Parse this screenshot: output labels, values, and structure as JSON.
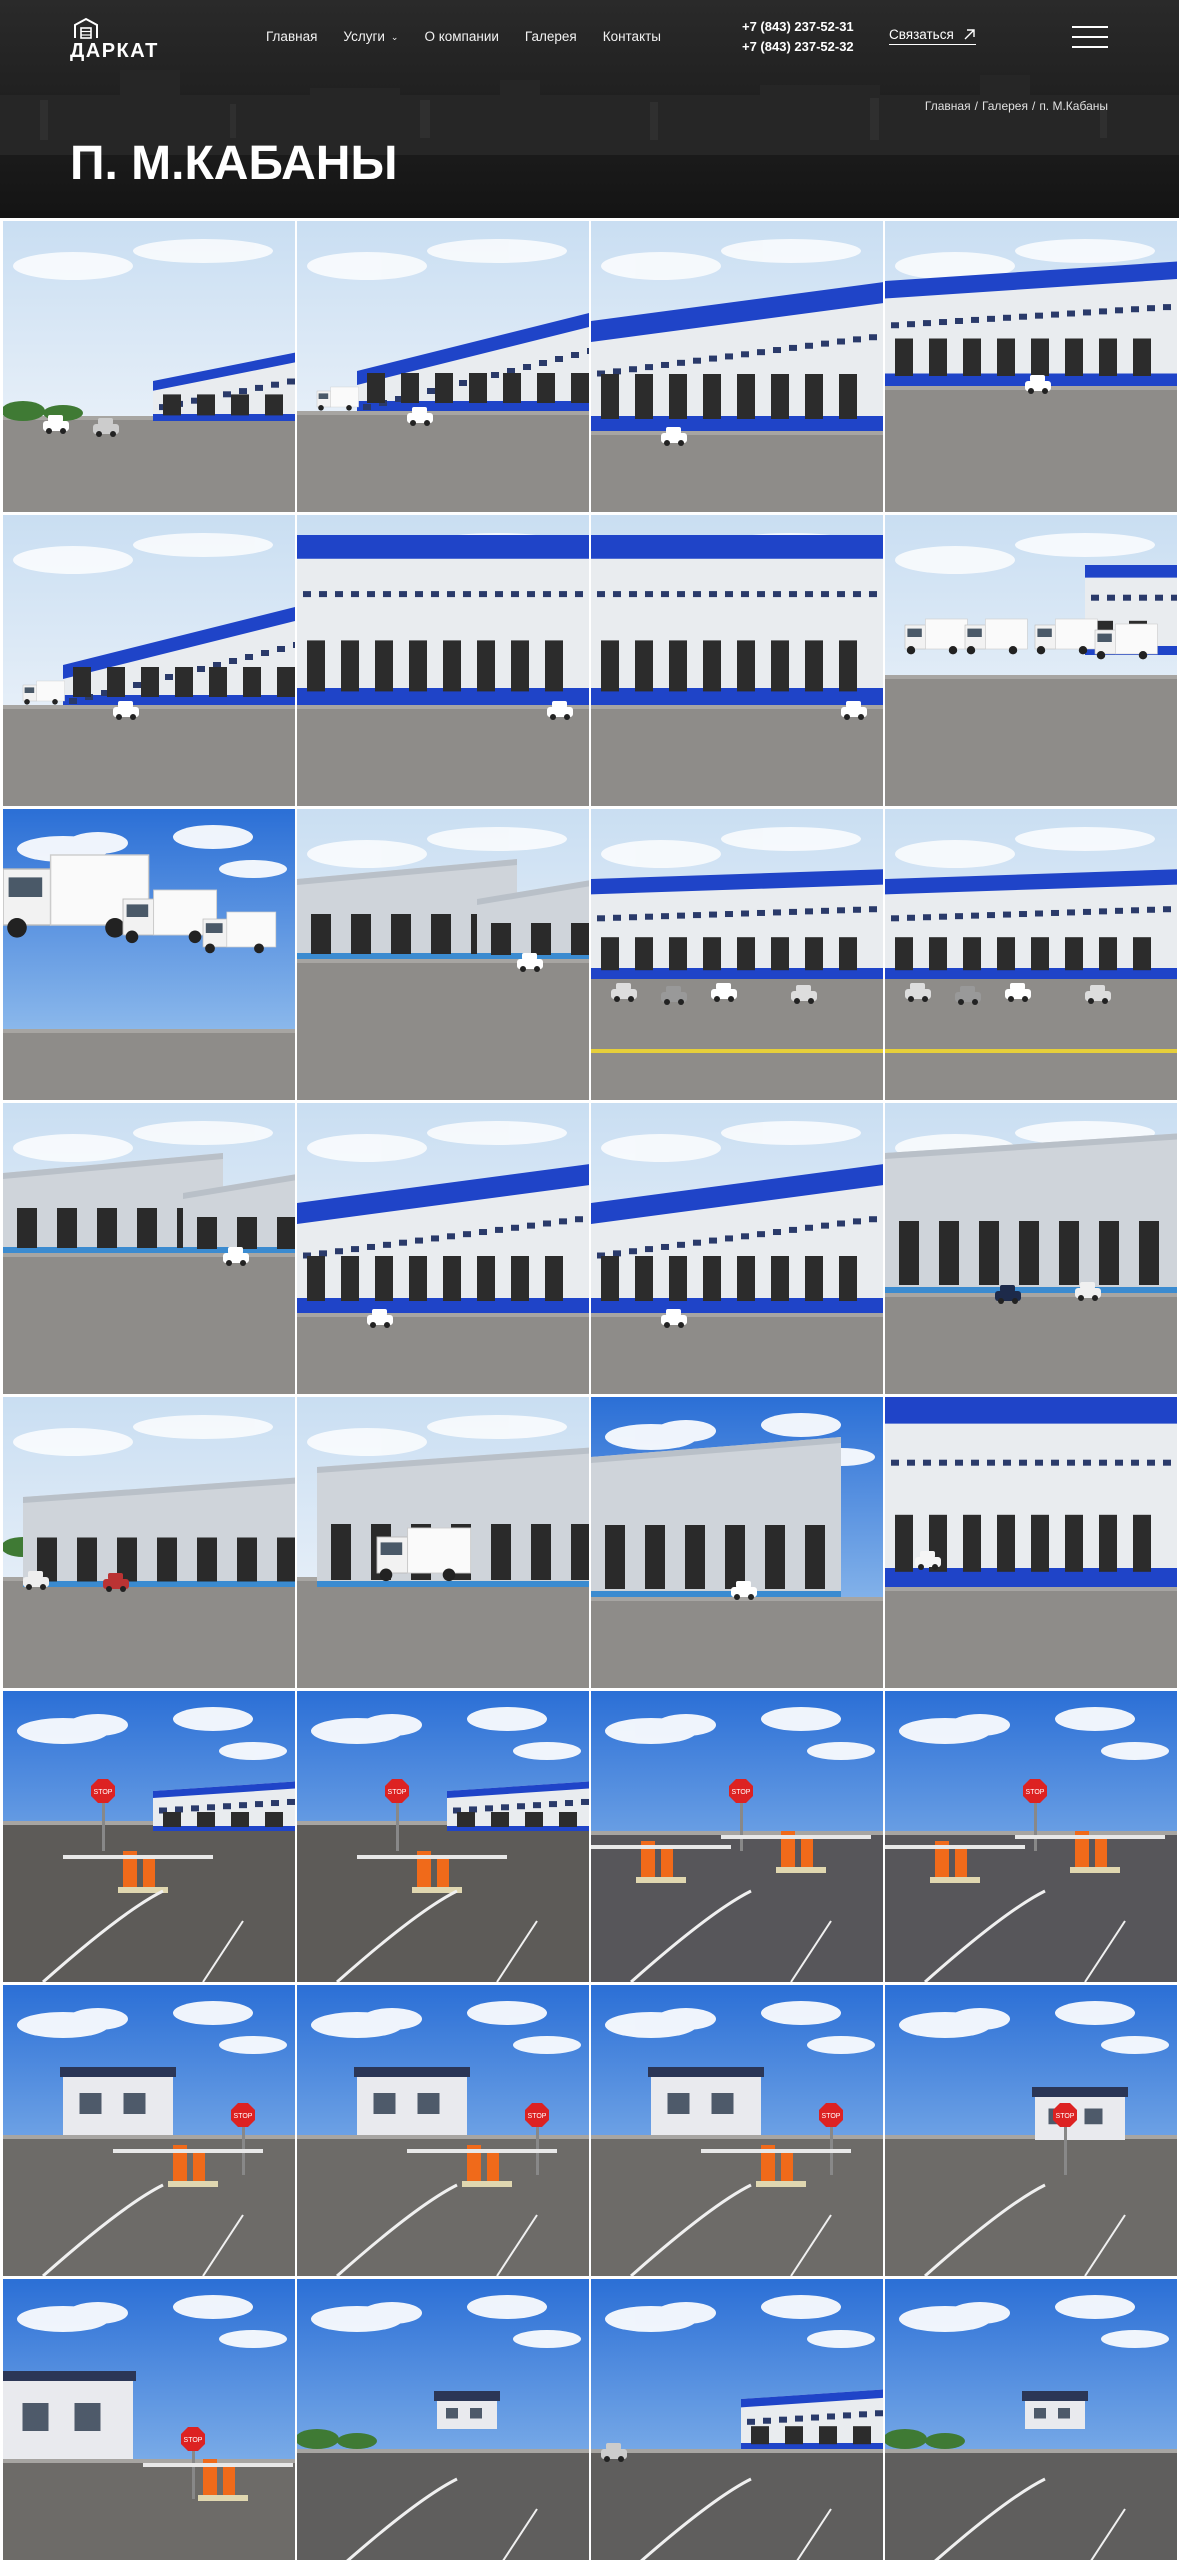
{
  "header": {
    "logo_text": "ДАРКАТ",
    "nav": [
      {
        "label": "Главная",
        "has_dropdown": false
      },
      {
        "label": "Услуги",
        "has_dropdown": true
      },
      {
        "label": "О компании",
        "has_dropdown": false
      },
      {
        "label": "Галерея",
        "has_dropdown": false
      },
      {
        "label": "Контакты",
        "has_dropdown": false
      }
    ],
    "phones": [
      "+7 (843) 237-52-31",
      "+7 (843) 237-52-32"
    ],
    "contact_button": "Связаться",
    "icons": {
      "logo": "building-logo-icon",
      "contact": "arrow-up-right-icon",
      "menu": "burger-menu-icon",
      "dropdown": "chevron-down-icon"
    }
  },
  "breadcrumb": [
    "Главная",
    "Галерея",
    "п. М.Кабаны"
  ],
  "page_title": "П. М.КАБАНЫ",
  "gallery": {
    "photos": [
      {
        "type": "warehouse-far"
      },
      {
        "type": "warehouse-long"
      },
      {
        "type": "warehouse-blue"
      },
      {
        "type": "warehouse-blue-docks"
      },
      {
        "type": "warehouse-long"
      },
      {
        "type": "warehouse-blue-close"
      },
      {
        "type": "warehouse-blue-close"
      },
      {
        "type": "trucks-row"
      },
      {
        "type": "trucks-close"
      },
      {
        "type": "grey-building"
      },
      {
        "type": "warehouse-cars"
      },
      {
        "type": "warehouse-cars"
      },
      {
        "type": "grey-building"
      },
      {
        "type": "warehouse-blue"
      },
      {
        "type": "warehouse-blue"
      },
      {
        "type": "grey-warehouse-car"
      },
      {
        "type": "grey-warehouse-wide"
      },
      {
        "type": "grey-warehouse-truck"
      },
      {
        "type": "grey-wall"
      },
      {
        "type": "grey-wall-suv"
      },
      {
        "type": "barrier-stop"
      },
      {
        "type": "barrier-stop"
      },
      {
        "type": "barrier-orange"
      },
      {
        "type": "barrier-orange"
      },
      {
        "type": "booth"
      },
      {
        "type": "booth"
      },
      {
        "type": "booth"
      },
      {
        "type": "booth-far"
      },
      {
        "type": "booth-small"
      },
      {
        "type": "road-booth"
      },
      {
        "type": "road-warehouse"
      },
      {
        "type": "road-booth"
      }
    ]
  },
  "colors": {
    "header_bg": "#1f1f1f",
    "facade_blue": "#1f44c8",
    "asphalt": "#8f8d8a",
    "sky": "#3d86e0"
  }
}
